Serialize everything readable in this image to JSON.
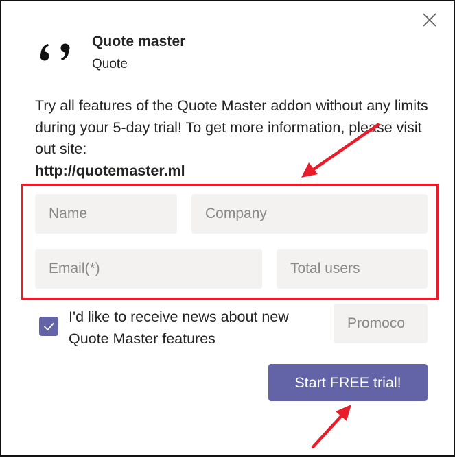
{
  "dialog": {
    "close_icon": "close-icon",
    "app_icon": "quote-marks-icon",
    "title": "Quote master",
    "subtitle": "Quote"
  },
  "description": {
    "text": "Try all features of the Quote Master addon without any limits during your 5-day trial! To get more information, please visit out site:",
    "link": "http://quotemaster.ml"
  },
  "form": {
    "name": {
      "placeholder": "Name",
      "value": ""
    },
    "company": {
      "placeholder": "Company",
      "value": ""
    },
    "email": {
      "placeholder": "Email(*)",
      "value": ""
    },
    "total_users": {
      "placeholder": "Total users",
      "value": ""
    },
    "promocode": {
      "placeholder": "Promoco",
      "value": ""
    },
    "newsletter": {
      "label": "I'd like to receive news about new Quote Master features",
      "checked": true
    },
    "submit_label": "Start FREE trial!"
  },
  "colors": {
    "accent": "#6264a7",
    "annotation": "#e81c2a",
    "field_background": "#f3f2f1",
    "text": "#252423",
    "placeholder": "#8a8886"
  },
  "annotations": {
    "highlight_box": "form-fields-highlight",
    "arrows": [
      "arrow-to-form-fields",
      "arrow-to-start-trial-button"
    ]
  }
}
